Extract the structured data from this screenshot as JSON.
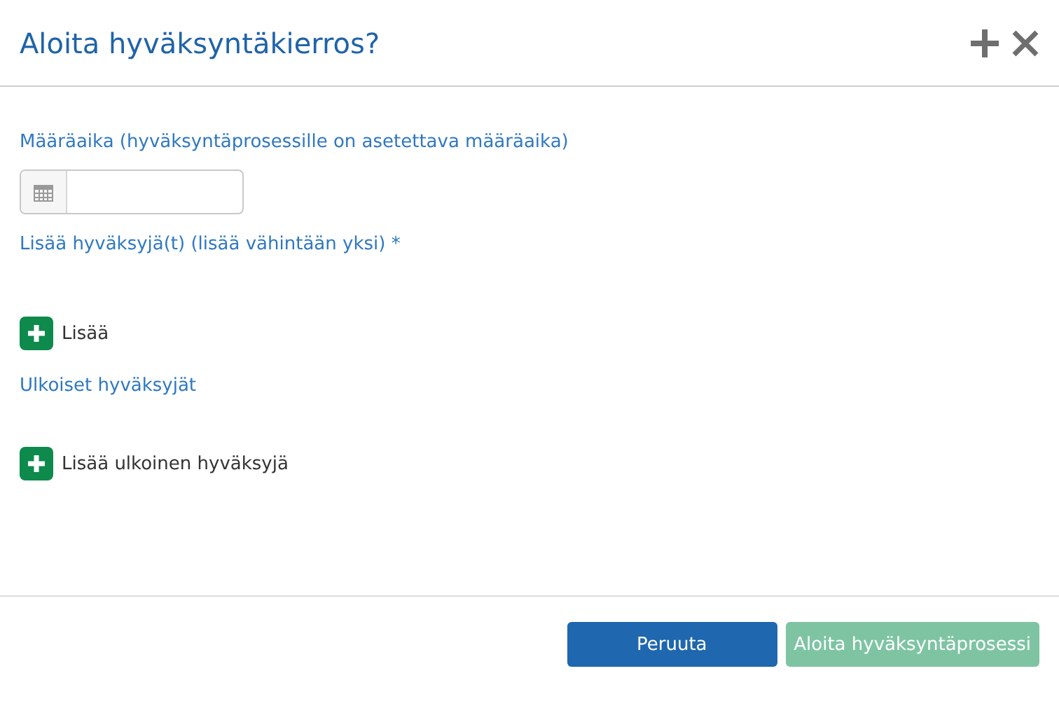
{
  "dialog": {
    "title": "Aloita hyväksyntäkierros?"
  },
  "deadline": {
    "label": "Määräaika (hyväksyntäprosessille on asetettava määräaika)"
  },
  "approvers": {
    "label": "Lisää hyväksyjä(t) (lisää vähintään yksi) *",
    "add_button": "Lisää"
  },
  "external_approvers": {
    "label": "Ulkoiset hyväksyjät",
    "add_button": "Lisää ulkoinen hyväksyjä"
  },
  "buttons": [
    {
      "label": "Peruuta",
      "kind": "secondary",
      "disabled": false
    },
    {
      "label": "Aloita hyväksyntäprosessi",
      "kind": "primary",
      "disabled": true
    }
  ]
}
